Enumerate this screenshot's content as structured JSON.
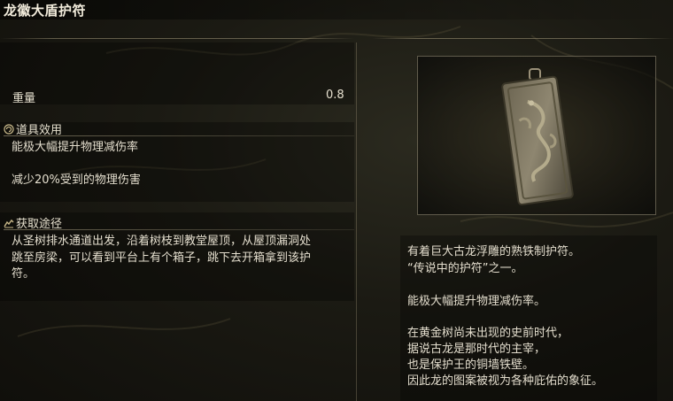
{
  "title": "龙徽大盾护符",
  "weight": {
    "label": "重量",
    "value": "0.8"
  },
  "effect": {
    "heading": "道具效用",
    "icon": "swirl-icon",
    "lines": [
      "能极大幅提升物理减伤率",
      "减少20%受到的物理伤害"
    ]
  },
  "obtain": {
    "heading": "获取途径",
    "icon": "hand-icon",
    "lines": [
      "从圣树排水通道出发，沿着树枝到教堂屋顶，从屋顶漏洞处",
      "跳至房梁，可以看到平台上有个箱子，跳下去开箱拿到该护",
      "符。"
    ]
  },
  "item_image": "dragon-crest-talisman-image",
  "description": [
    "有着巨大古龙浮雕的熟铁制护符。",
    "“传说中的护符”之一。",
    "",
    "能极大幅提升物理减伤率。",
    "",
    "在黄金树尚未出现的史前时代，",
    "据说古龙是那时代的主宰，",
    "也是保护王的铜墙铁壁。",
    "因此龙的图案被视为各种庇佑的象征。"
  ]
}
